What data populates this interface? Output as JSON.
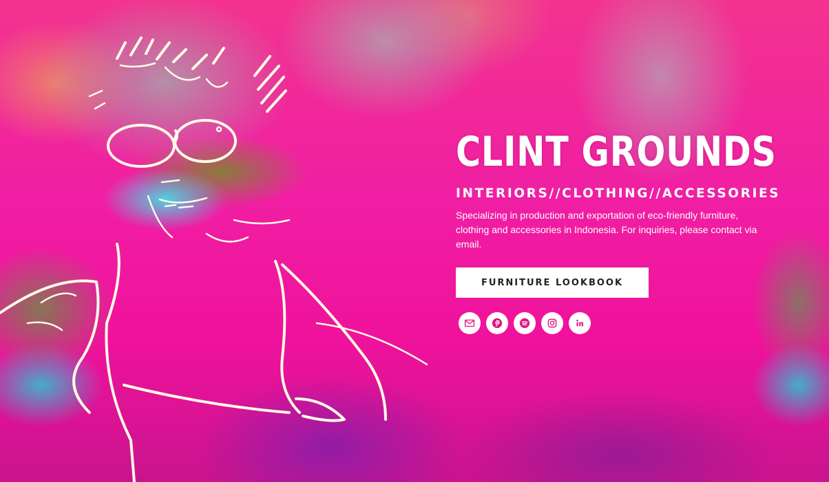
{
  "hero": {
    "title": "CLINT GROUNDS",
    "tagline": "INTERIORS//CLOTHING//ACCESSORIES",
    "description": "Specializing in production and exportation of eco-friendly furniture, clothing and accessories in Indonesia.  For inquiries, please contact via email.",
    "cta_label": "FURNITURE LOOKBOOK"
  },
  "social": [
    {
      "icon": "email-icon"
    },
    {
      "icon": "pinterest-icon"
    },
    {
      "icon": "spotify-icon"
    },
    {
      "icon": "instagram-icon"
    },
    {
      "icon": "linkedin-icon"
    }
  ],
  "colors": {
    "background_pink": "#f01fa3",
    "button_bg": "#ffffff",
    "button_text": "#222222",
    "icon_color": "#e0157f"
  }
}
